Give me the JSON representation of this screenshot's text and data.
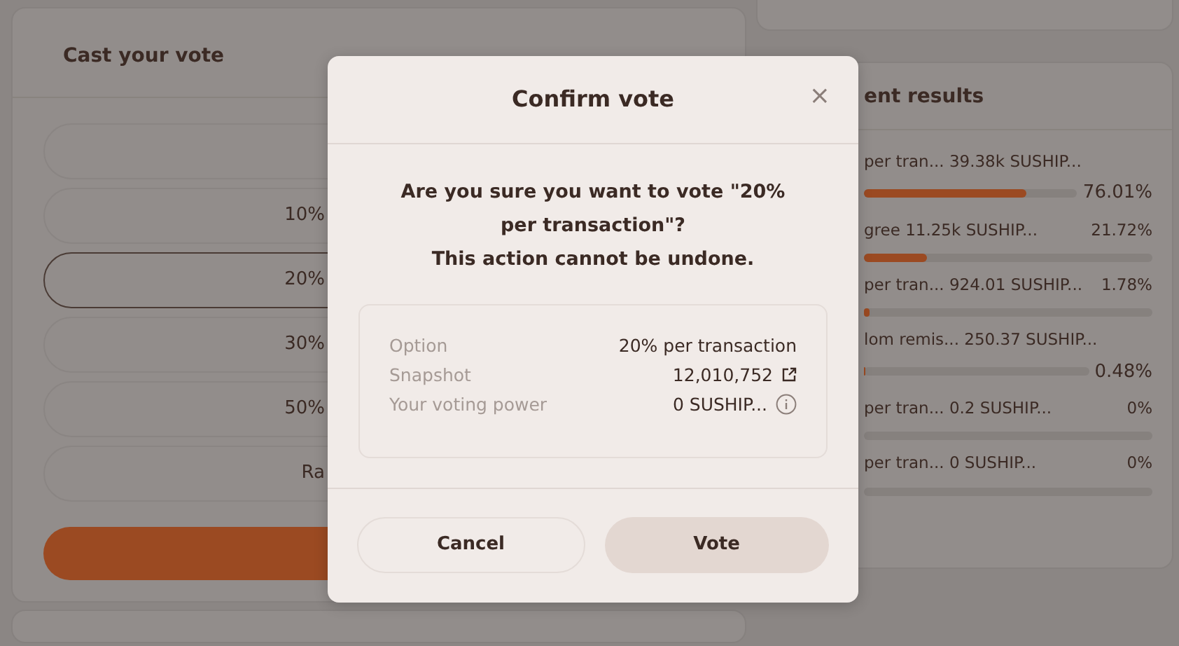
{
  "vote_panel": {
    "title": "Cast your vote",
    "options": [
      {
        "selected": false
      },
      {
        "label": "10%",
        "selected": false
      },
      {
        "label": "20%",
        "selected": true
      },
      {
        "label": "30%",
        "selected": false
      },
      {
        "label": "50%",
        "selected": false
      },
      {
        "label": "Ra",
        "selected": false
      }
    ]
  },
  "results_panel": {
    "title": "ent results",
    "rows": [
      {
        "text": "per tran... 39.38k SUSHIP...",
        "percent": "76.01%",
        "level": 0.7601,
        "kind": "wrapped"
      },
      {
        "text": "gree 11.25k SUSHIP...",
        "percent": "21.72%",
        "level": 0.2172,
        "kind": "inline"
      },
      {
        "text": "per tran... 924.01 SUSHIP...",
        "percent": "1.78%",
        "level": 0.0178,
        "kind": "inline"
      },
      {
        "text": "lom remis... 250.37 SUSHIP...",
        "percent": "0.48%",
        "level": 0.0048,
        "kind": "wrapped"
      },
      {
        "text": "per tran... 0.2 SUSHIP...",
        "percent": "0%",
        "kind": "inline"
      },
      {
        "text": "per tran... 0 SUSHIP...",
        "percent": "0%",
        "kind": "inline"
      }
    ]
  },
  "modal": {
    "title": "Confirm vote",
    "close": "×",
    "message": "Are you sure you want to vote \"20% per transaction\"?\nThis action cannot be undone.",
    "details": [
      {
        "label": "Option",
        "value": "20% per transaction",
        "kind": "plain"
      },
      {
        "label": "Snapshot",
        "value": "12,010,752",
        "kind": "link"
      },
      {
        "label": "Your voting power",
        "value": "0 SUSHIP...",
        "kind": "info"
      }
    ],
    "buttons": [
      {
        "label": "Cancel",
        "kind": "secondary"
      },
      {
        "label": "Vote",
        "kind": "primary"
      }
    ]
  }
}
